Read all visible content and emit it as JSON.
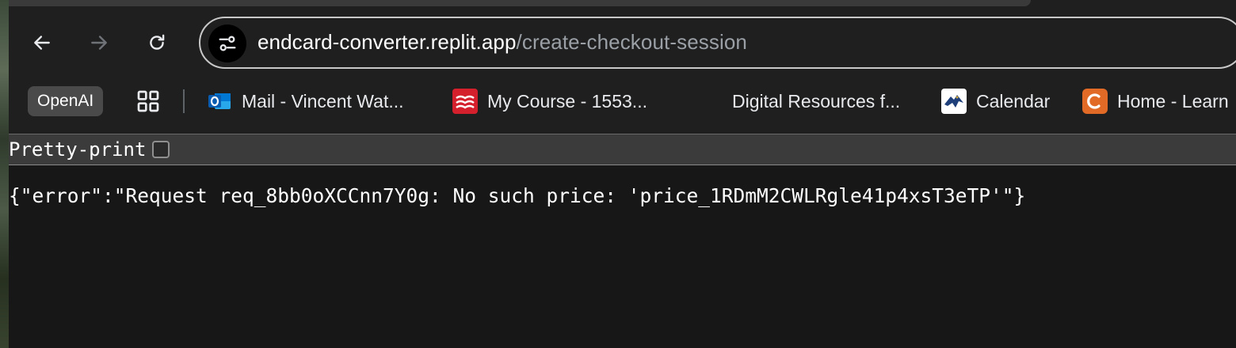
{
  "browser": {
    "nav": {
      "back_icon": "arrow-left-icon",
      "forward_icon": "arrow-right-icon",
      "reload_icon": "reload-icon"
    },
    "address_bar": {
      "host": "endcard-converter.replit.app",
      "path": "/create-checkout-session",
      "site_info_icon": "tune-icon"
    },
    "bookmarks": [
      {
        "label": "OpenAI",
        "icon": "none"
      },
      {
        "label": "",
        "icon": "apps-grid-icon"
      },
      {
        "label": "Mail - Vincent Wat...",
        "icon": "outlook-icon"
      },
      {
        "label": "My Course - 1553...",
        "icon": "mcgraw-hill-icon"
      },
      {
        "label": "Digital Resources f...",
        "icon": "none"
      },
      {
        "label": "Calendar",
        "icon": "eagle-icon"
      },
      {
        "label": "Home - Learn",
        "icon": "canvas-c-icon"
      }
    ]
  },
  "viewer": {
    "pretty_print_label": "Pretty-print",
    "pretty_print_checked": false,
    "body": "{\"error\":\"Request req_8bb0oXCCnn7Y0g: No such price: 'price_1RDmM2CWLRgle41p4xsT3eTP'\"}"
  },
  "colors": {
    "toolbar_bg": "#1f1f1f",
    "viewer_bg": "#171717",
    "url_host": "#ffffff",
    "url_path": "#9aa0a6",
    "outlook_blue": "#0a64c8",
    "mcgraw_red": "#d4202c",
    "canvas_orange": "#e06a26"
  }
}
